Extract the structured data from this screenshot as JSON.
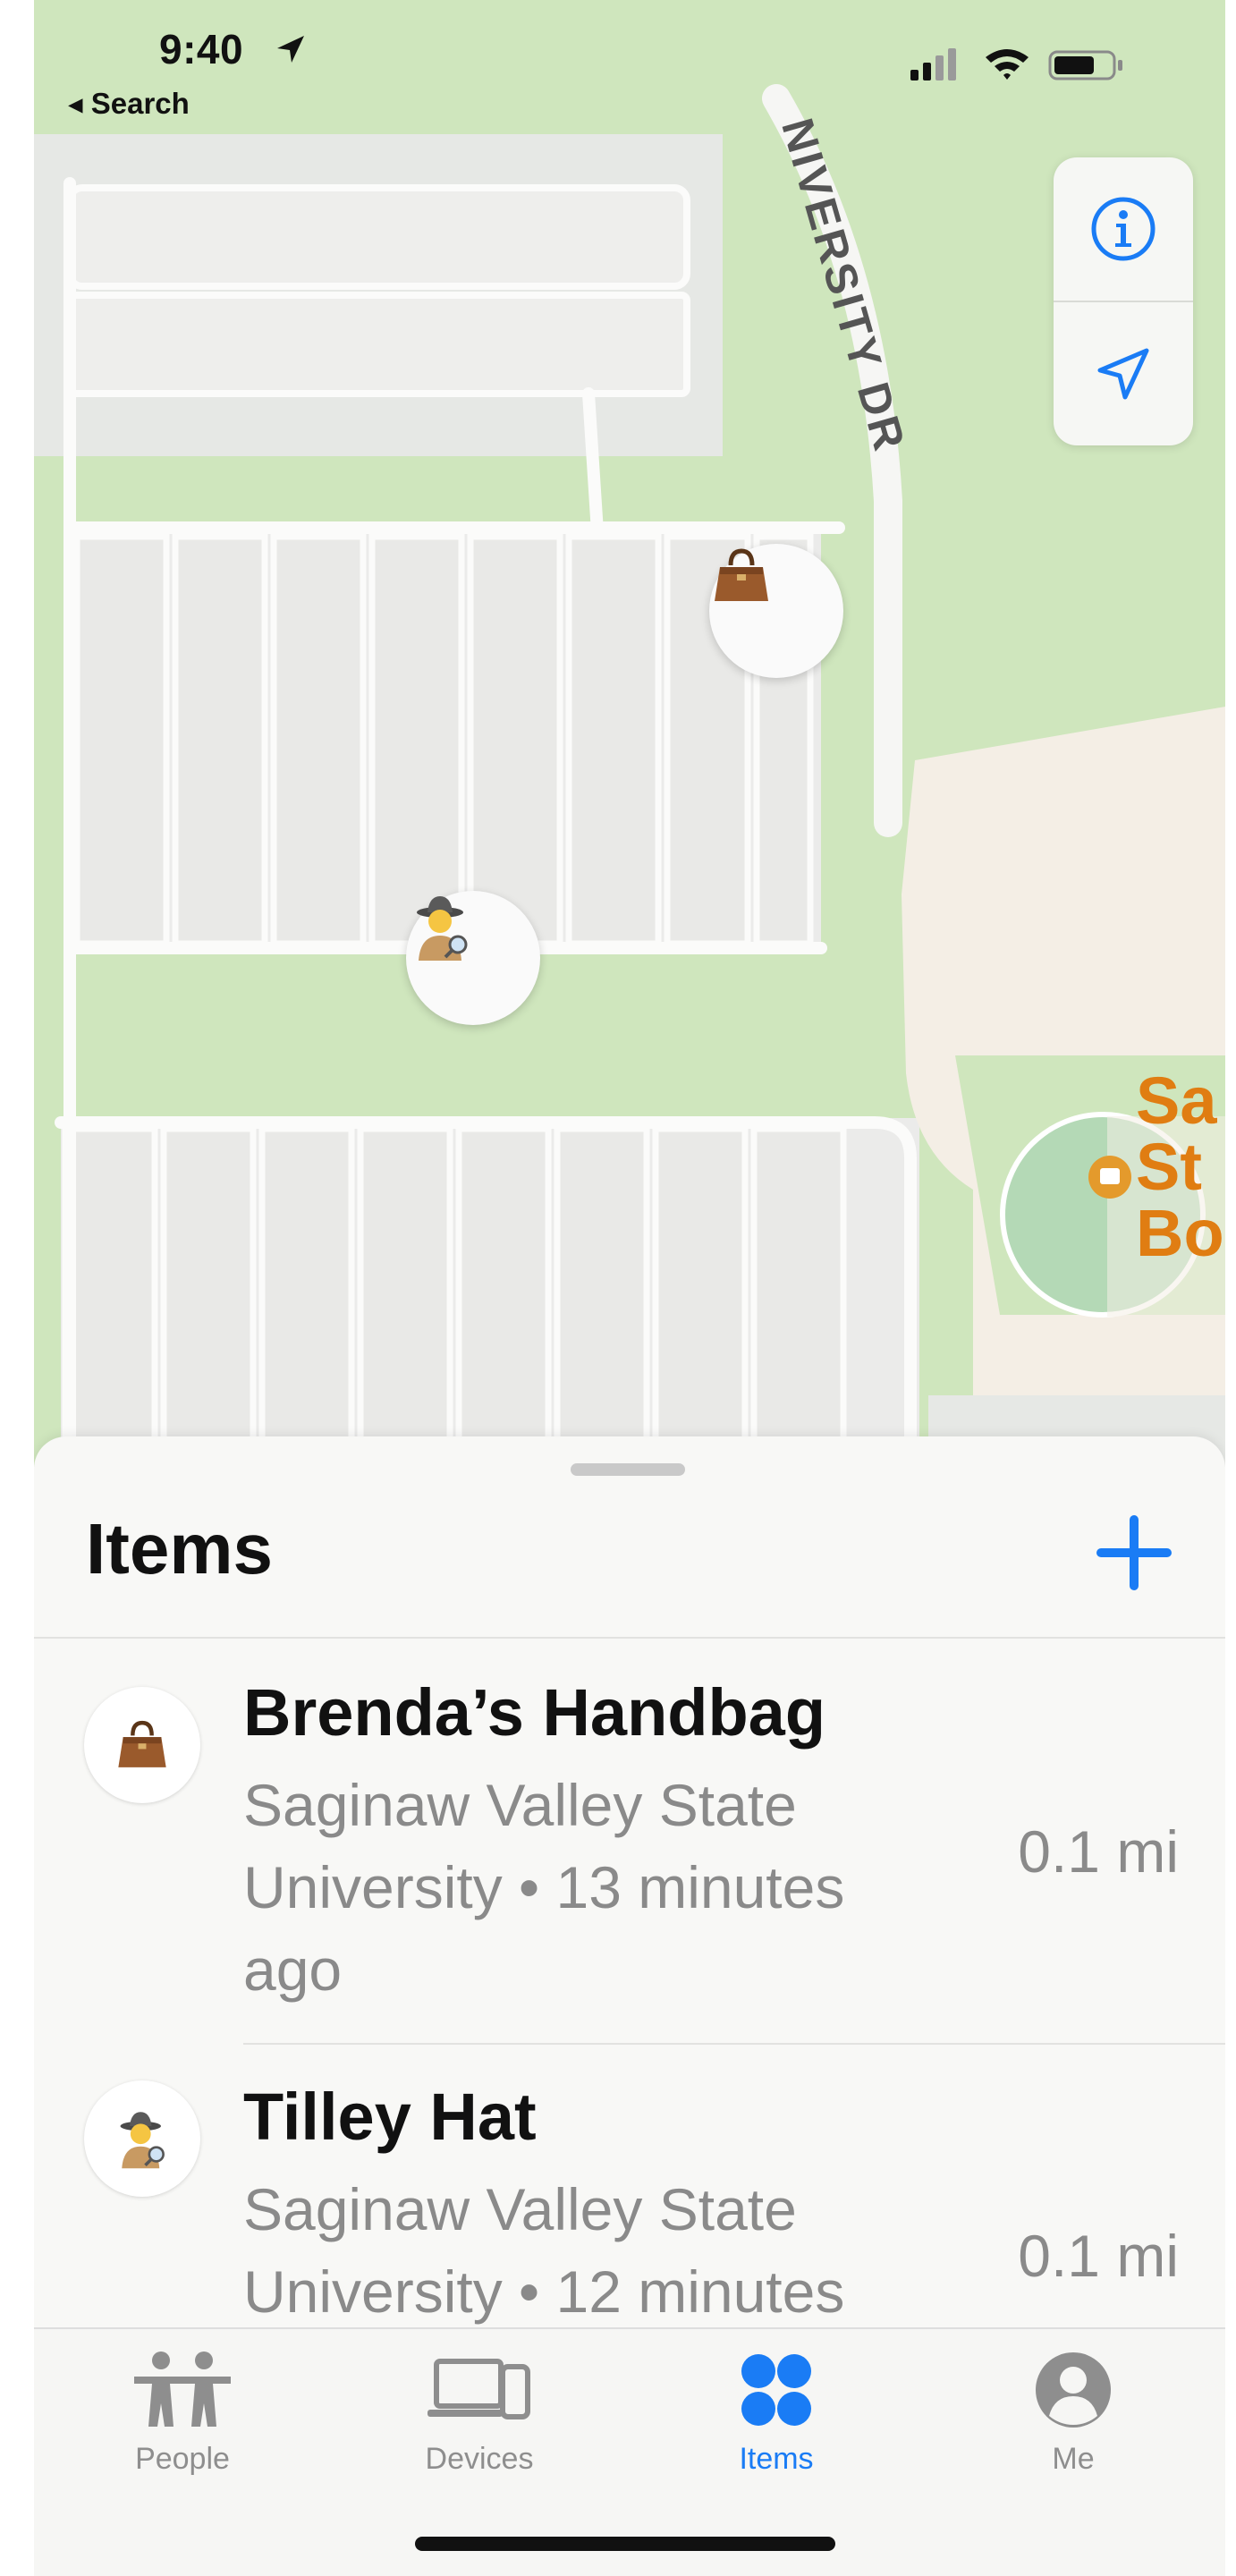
{
  "status_bar": {
    "time": "9:40",
    "back_label": "◂ Search"
  },
  "map": {
    "road_label": "NIVERSITY DR",
    "poi_label_lines": [
      "Sa",
      "St",
      "Bo"
    ],
    "pins": [
      {
        "name": "handbag-pin",
        "icon": "handbag-icon"
      },
      {
        "name": "detective-pin",
        "icon": "detective-icon"
      }
    ],
    "controls": [
      {
        "name": "info-button",
        "icon": "info-icon"
      },
      {
        "name": "location-button",
        "icon": "location-arrow-icon"
      }
    ]
  },
  "sheet": {
    "title": "Items",
    "add_icon": "plus-icon",
    "items": [
      {
        "name": "Brenda’s Handbag",
        "location": "Saginaw Valley State University • 13 minutes ago",
        "distance": "0.1 mi",
        "icon": "handbag-icon"
      },
      {
        "name": "Tilley Hat",
        "location": "Saginaw Valley State University • 12 minutes",
        "distance": "0.1 mi",
        "icon": "detective-icon"
      }
    ]
  },
  "tabbar": {
    "tabs": [
      {
        "label": "People",
        "icon": "people-icon",
        "active": false
      },
      {
        "label": "Devices",
        "icon": "devices-icon",
        "active": false
      },
      {
        "label": "Items",
        "icon": "items-icon",
        "active": true
      },
      {
        "label": "Me",
        "icon": "person-circle-icon",
        "active": false
      }
    ]
  },
  "colors": {
    "accent": "#1a7cf5",
    "map_green": "#cfe6bd",
    "parking": "#e9ebe8",
    "poi": "#e07d12"
  }
}
